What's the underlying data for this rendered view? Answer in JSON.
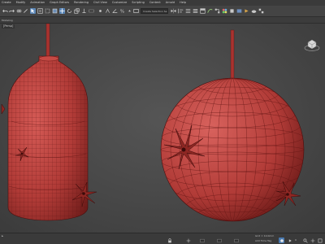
{
  "menubar": {
    "items": [
      "Create",
      "Modify",
      "Animation",
      "Graph Editors",
      "Rendering",
      "Civil View",
      "Customize",
      "Scripting",
      "Content",
      "Arnold",
      "Help"
    ]
  },
  "toolbar": {
    "selection_set_placeholder": "Create Selection Se"
  },
  "ribbon": {
    "label": "Modeling"
  },
  "viewport": {
    "label": "[Persp]",
    "background": "#474747",
    "mesh_color": "#b8403d",
    "wire_color": "#5e1412"
  },
  "status": {
    "grid_text": "Grid = 10.0mm",
    "add_time_tag": "Add Time Tag",
    "frame": "0"
  }
}
